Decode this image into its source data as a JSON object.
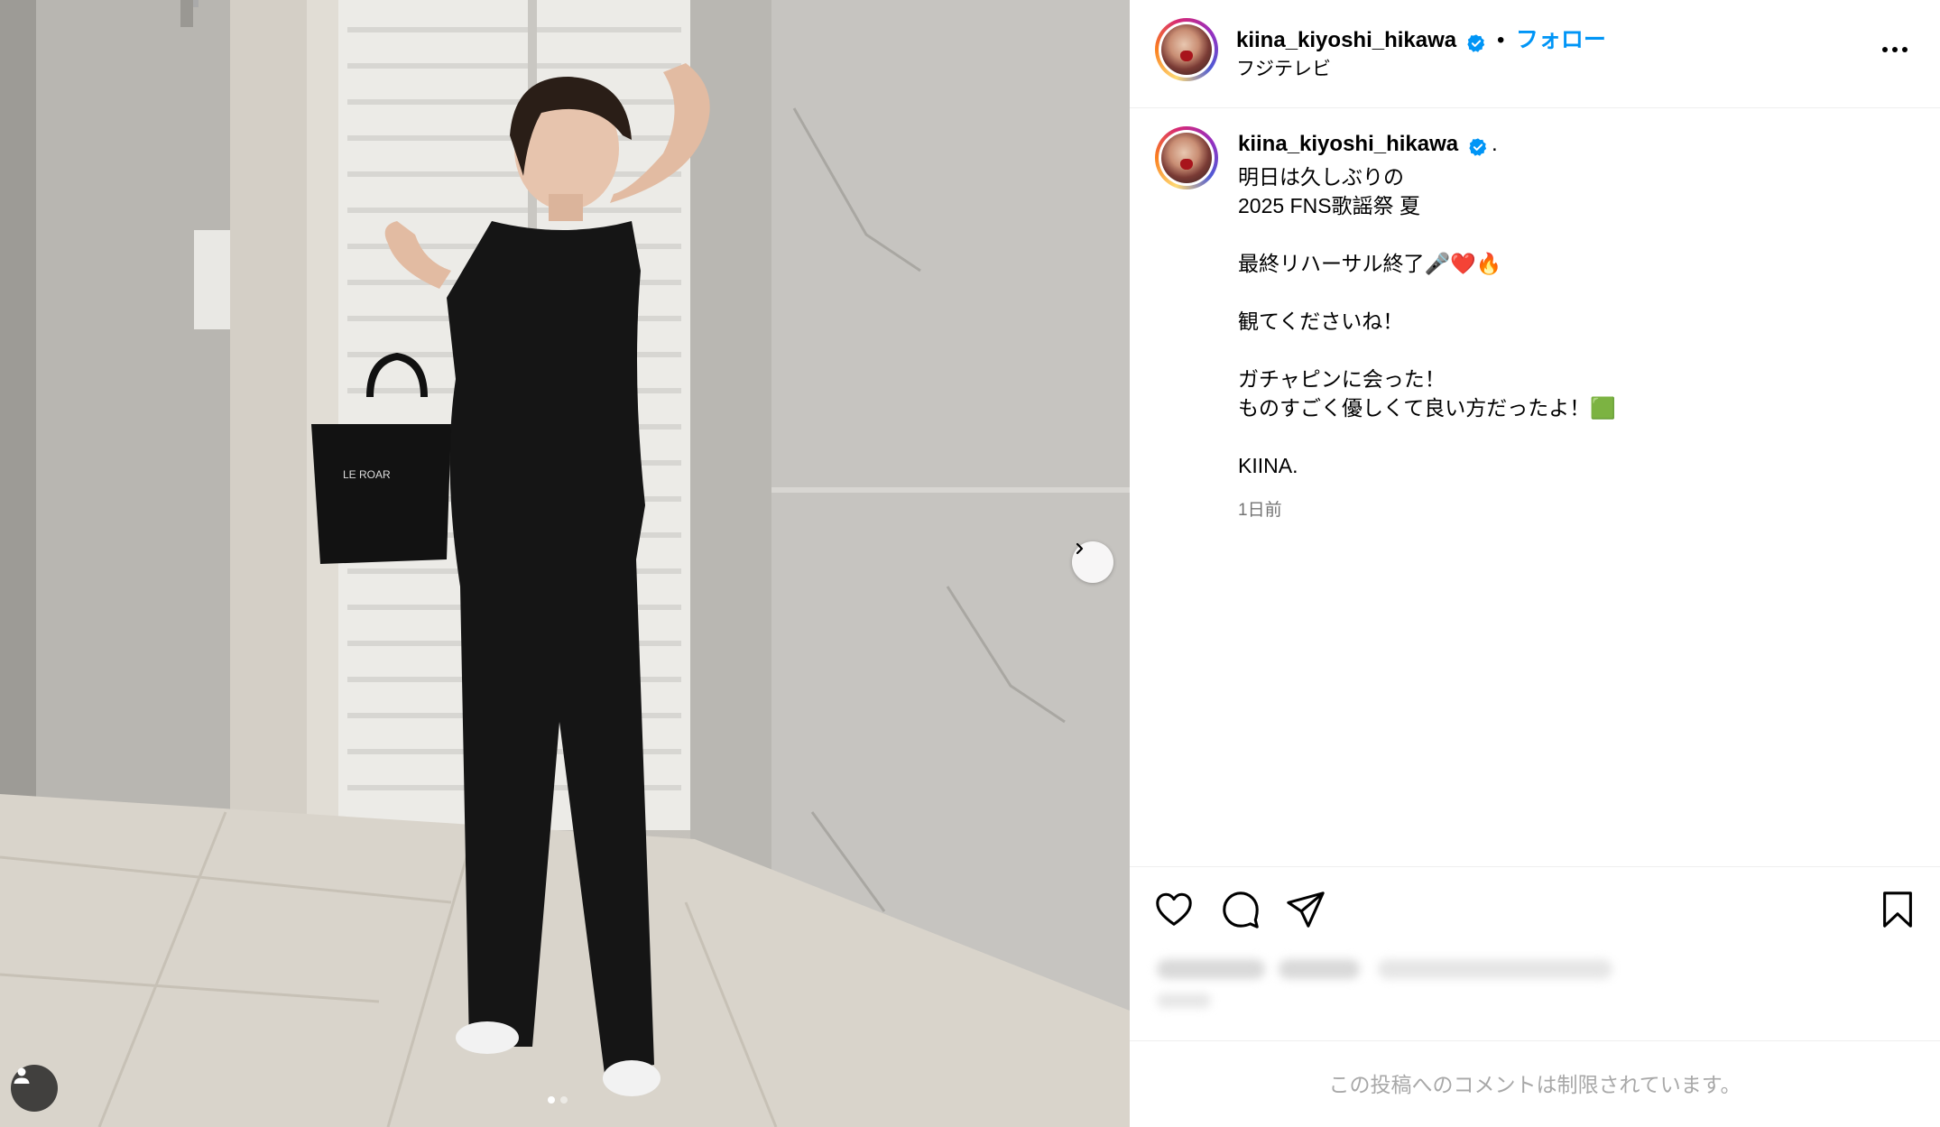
{
  "post": {
    "username": "kiina_kiyoshi_hikawa",
    "follow_label": "フォロー",
    "separator": "•",
    "subtitle": "フジテレビ",
    "caption": {
      "username": "kiina_kiyoshi_hikawa",
      "dot": ".",
      "lines": [
        "明日は久しぶりの",
        "2025 FNS歌謡祭 夏",
        "",
        "最終リハーサル終了🎤❤️🔥",
        "",
        "観てくださいね！",
        "",
        "ガチャピンに会った！",
        "ものすごく優しくて良い方だったよ！🟩",
        "",
        "KIINA."
      ]
    },
    "timestamp": "1日前",
    "comments_restricted": "この投稿へのコメントは制限されています。",
    "bag_text": "LE ROAR"
  },
  "carousel": {
    "total": 2,
    "current": 1
  },
  "colors": {
    "accent": "#0095f6",
    "verified": "#0095f6",
    "muted": "#737373",
    "border": "#efefef"
  },
  "icons": {
    "like": "heart-icon",
    "comment": "comment-icon",
    "share": "paper-plane-icon",
    "save": "bookmark-icon",
    "more": "more-options-icon",
    "next": "chevron-right-icon",
    "tag": "user-tag-icon"
  }
}
